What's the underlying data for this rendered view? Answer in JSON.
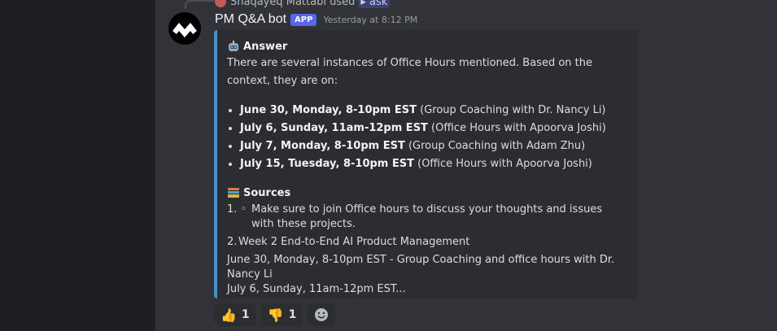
{
  "reply": {
    "user": "Shaqayeq Mattabi",
    "used_text": "used",
    "command": "ask"
  },
  "message": {
    "bot_name": "PM Q&A bot",
    "badge": "APP",
    "timestamp": "Yesterday at 8:12 PM"
  },
  "embed": {
    "answer_title": "Answer",
    "answer_intro": "There are several instances of Office Hours mentioned. Based on the context, they are on:",
    "items": [
      {
        "bold": "June 30, Monday, 8-10pm EST",
        "rest": " (Group Coaching with Dr. Nancy Li)"
      },
      {
        "bold": "July 6, Sunday, 11am-12pm EST",
        "rest": " (Office Hours with Apoorva Joshi)"
      },
      {
        "bold": "July 7, Monday, 8-10pm EST",
        "rest": " (Group Coaching with Adam Zhu)"
      },
      {
        "bold": "July 15, Tuesday, 8-10pm EST",
        "rest": " (Office Hours with Apoorva Joshi)"
      }
    ],
    "sources_title": "Sources",
    "sources": [
      {
        "num": "1. ◦",
        "text": "Make sure to join Office hours to discuss your thoughts and issues with these projects."
      },
      {
        "num": "2.",
        "text": "Week 2 End-to-End AI Product Management"
      }
    ],
    "snippet_line1": "June 30, Monday, 8-10pm EST - Group Coaching and office hours with Dr. Nancy Li",
    "snippet_line2": "July 6, Sunday, 11am-12pm EST..."
  },
  "reactions": [
    {
      "emoji": "thumbs-up",
      "count": "1"
    },
    {
      "emoji": "thumbs-down",
      "count": "1"
    }
  ],
  "colors": {
    "accent": "#3498db",
    "badge": "#5865f2",
    "background": "#313338"
  }
}
